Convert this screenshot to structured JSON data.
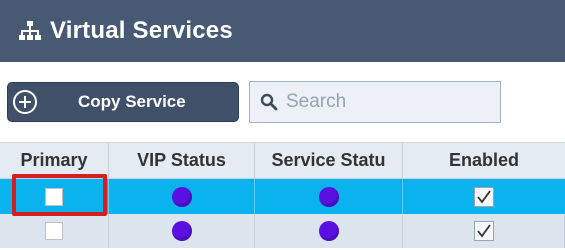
{
  "header": {
    "title": "Virtual Services",
    "icon": "sitemap-icon"
  },
  "toolbar": {
    "copy_label": "Copy Service",
    "copy_icon": "add-circle-icon",
    "search_placeholder": "Search",
    "search_value": ""
  },
  "table": {
    "columns": [
      "Primary",
      "VIP Status",
      "Service Statu",
      "Enabled"
    ],
    "rows": [
      {
        "primary": false,
        "vip_status": "purple-dot",
        "service_status": "purple-dot",
        "enabled": true,
        "selected": true
      },
      {
        "primary": false,
        "vip_status": "purple-dot",
        "service_status": "purple-dot",
        "enabled": true,
        "selected": false
      }
    ]
  },
  "colors": {
    "header_bg": "#485a73",
    "selected_row": "#0bb3ee",
    "status_dot": "#5a10e0",
    "highlight": "#d31f1f"
  }
}
